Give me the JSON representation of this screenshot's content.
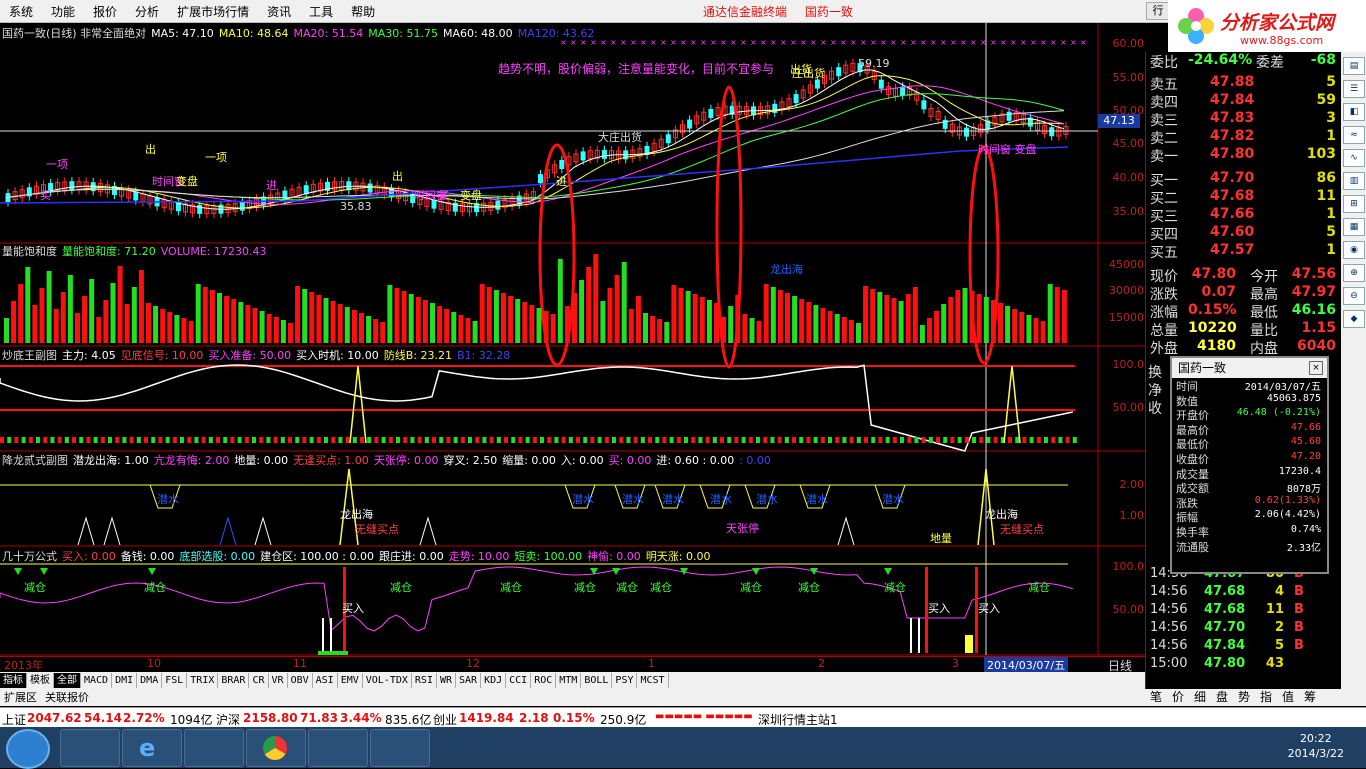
{
  "menu": [
    "系统",
    "功能",
    "报价",
    "分析",
    "扩展市场行情",
    "资讯",
    "工具",
    "帮助"
  ],
  "app_title": [
    "通达信金融终端",
    "国药一致"
  ],
  "logo": {
    "text": "分析家公式网",
    "url": "www.88gs.com"
  },
  "main_legend": {
    "prefix": "国药一致(日线) 非常全面绝对",
    "ma": [
      {
        "label": "MA5: 47.10",
        "color": "#ffffff"
      },
      {
        "label": "MA10: 48.64",
        "color": "#ffff40"
      },
      {
        "label": "MA20: 51.54",
        "color": "#ff40ff"
      },
      {
        "label": "MA30: 51.75",
        "color": "#40ff40"
      },
      {
        "label": "MA60: 48.00",
        "color": "#ffffff"
      },
      {
        "label": "MA120: 43.62",
        "color": "#4040ff"
      }
    ]
  },
  "main_axis": [
    "60.00",
    "55.00",
    "50.00",
    "45.00",
    "40.00",
    "35.00"
  ],
  "current_price_tag": "47.13",
  "annotation_top": "趋势不明，股价偏弱，注意量能变化，目前不宜参与",
  "chart_texts": {
    "low_price": "35.83",
    "high_price": "59.19",
    "vol_label": "龙出海",
    "top1": "大庄出货",
    "top2": "庄出货",
    "labels": [
      "一项",
      "出",
      "买",
      "一项",
      "进",
      "出",
      "买",
      "进",
      "时间窗",
      "变盘",
      "时间窗",
      "变盘",
      "时间窗 变盘",
      "出货"
    ]
  },
  "vol_legend": {
    "name": "量能饱和度",
    "items": [
      {
        "label": "量能饱和度: 71.20",
        "color": "#40ff40"
      },
      {
        "label": "VOLUME: 17230.43",
        "color": "#ff40ff"
      }
    ]
  },
  "vol_axis": [
    "45000",
    "30000",
    "15000"
  ],
  "ind1_legend": {
    "name": "炒底王副图",
    "items": [
      {
        "label": "主力: 4.05",
        "color": "#ffffff"
      },
      {
        "label": "见底信号: 10.00",
        "color": "#ff4040"
      },
      {
        "label": "买入准备: 50.00",
        "color": "#ff40ff"
      },
      {
        "label": "买入时机: 10.00",
        "color": "#ffffff"
      },
      {
        "label": "防线B: 23.21",
        "color": "#ffff40"
      },
      {
        "label": "B1: 32.28",
        "color": "#4040ff"
      }
    ]
  },
  "ind1_axis": [
    "100.0",
    "50.00"
  ],
  "ind2_legend": {
    "name": "降龙贰式副图",
    "items": [
      {
        "label": "潜龙出海: 1.00",
        "color": "#ffffff"
      },
      {
        "label": "亢龙有悔: 2.00",
        "color": "#ff40ff"
      },
      {
        "label": "地量: 0.00",
        "color": "#ffffff"
      },
      {
        "label": "无逢买点: 1.00",
        "color": "#ff4040"
      },
      {
        "label": "天张停: 0.00",
        "color": "#ff40ff"
      },
      {
        "label": "穿叉: 2.50",
        "color": "#ffffff"
      },
      {
        "label": "缩量: 0.00",
        "color": "#ffffff"
      },
      {
        "label": "入: 0.00",
        "color": "#ffffff"
      },
      {
        "label": "买: 0.00",
        "color": "#ff40ff"
      },
      {
        "label": "进: 0.60 : 0.00",
        "color": "#ffffff"
      },
      {
        "label": ": 0.00",
        "color": "#4040ff"
      }
    ]
  },
  "ind2_axis": [
    "2.00",
    "1.00"
  ],
  "ind2_texts": {
    "water": "潜水",
    "sky": "天张停",
    "dragon": "龙出海",
    "buy": "无缝买点",
    "ground": "地量"
  },
  "ind3_legend": {
    "name": "几十万公式",
    "items": [
      {
        "label": "买入: 0.00",
        "color": "#ff4040"
      },
      {
        "label": "备钱: 0.00",
        "color": "#ffffff"
      },
      {
        "label": "底部选股: 0.00",
        "color": "#40ffff"
      },
      {
        "label": "建仓区: 100.00 : 0.00",
        "color": "#ffffff"
      },
      {
        "label": "跟庄进: 0.00",
        "color": "#ffffff"
      },
      {
        "label": "走势: 10.00",
        "color": "#ff40ff"
      },
      {
        "label": "短卖: 100.00",
        "color": "#40ff40"
      },
      {
        "label": "神偷: 0.00",
        "color": "#ff40ff"
      },
      {
        "label": "明天涨: 0.00",
        "color": "#ffff40"
      }
    ]
  },
  "ind3_axis": [
    "100.0",
    "50.00"
  ],
  "ind3_texts": {
    "reduce": "减仓",
    "buy": "买入"
  },
  "time_axis": {
    "labels": [
      "2013年",
      "10",
      "11",
      "12",
      "1",
      "2",
      "3"
    ],
    "cursor_date": "2014/03/07/五",
    "period": "日线"
  },
  "quote": {
    "weibi": {
      "label": "委比",
      "value": "-24.64%",
      "label2": "委差",
      "value2": "-68"
    },
    "sell": [
      {
        "label": "卖五",
        "price": "47.88",
        "vol": "5"
      },
      {
        "label": "卖四",
        "price": "47.84",
        "vol": "59"
      },
      {
        "label": "卖三",
        "price": "47.83",
        "vol": "3"
      },
      {
        "label": "卖二",
        "price": "47.82",
        "vol": "1"
      },
      {
        "label": "卖一",
        "price": "47.80",
        "vol": "103"
      }
    ],
    "buy": [
      {
        "label": "买一",
        "price": "47.70",
        "vol": "86"
      },
      {
        "label": "买二",
        "price": "47.68",
        "vol": "11"
      },
      {
        "label": "买三",
        "price": "47.66",
        "vol": "1"
      },
      {
        "label": "买四",
        "price": "47.60",
        "vol": "5"
      },
      {
        "label": "买五",
        "price": "47.57",
        "vol": "1"
      }
    ],
    "stats": [
      {
        "l1": "现价",
        "v1": "47.80",
        "l2": "今开",
        "v2": "47.56"
      },
      {
        "l1": "涨跌",
        "v1": "0.07",
        "l2": "最高",
        "v2": "47.97"
      },
      {
        "l1": "涨幅",
        "v1": "0.15%",
        "l2": "最低",
        "v2": "46.16"
      },
      {
        "l1": "总量",
        "v1": "10220",
        "l2": "量比",
        "v2": "1.15"
      },
      {
        "l1": "外盘",
        "v1": "4180",
        "l2": "内盘",
        "v2": "6040"
      }
    ],
    "partial": [
      "换",
      "净",
      "收"
    ],
    "ticks": [
      {
        "t": "14:56",
        "p": "47.67",
        "v": "80",
        "d": "B"
      },
      {
        "t": "14:56",
        "p": "47.68",
        "v": "4",
        "d": "B"
      },
      {
        "t": "14:56",
        "p": "47.68",
        "v": "11",
        "d": "B"
      },
      {
        "t": "14:56",
        "p": "47.70",
        "v": "2",
        "d": "B"
      },
      {
        "t": "14:56",
        "p": "47.84",
        "v": "5",
        "d": "B"
      },
      {
        "t": "15:00",
        "p": "47.80",
        "v": "43",
        "d": ""
      }
    ]
  },
  "popup": {
    "title": "国药一致",
    "rows": [
      {
        "k": "时间",
        "v": "2014/03/07/五",
        "c": "#ffffff"
      },
      {
        "k": "数值",
        "v": "45063.875",
        "c": "#ffffff"
      },
      {
        "k": "开盘价",
        "v": "46.48 (-0.21%)",
        "c": "#40ff40"
      },
      {
        "k": "最高价",
        "v": "47.66",
        "c": "#ff4040"
      },
      {
        "k": "最低价",
        "v": "45.60",
        "c": "#ff4040"
      },
      {
        "k": "收盘价",
        "v": "47.20",
        "c": "#ff4040"
      },
      {
        "k": "成交量",
        "v": "17230.4",
        "c": "#ffffff"
      },
      {
        "k": "成交额",
        "v": "8078万",
        "c": "#ffffff"
      },
      {
        "k": "涨跌",
        "v": "0.62(1.33%)",
        "c": "#ff4040"
      },
      {
        "k": "振幅",
        "v": "2.06(4.42%)",
        "c": "#ffffff"
      },
      {
        "k": "换手率",
        "v": "0.74%",
        "c": "#ffffff"
      },
      {
        "k": "流通股",
        "v": "2.33亿",
        "c": "#ffffff"
      }
    ]
  },
  "bottom_tabs": [
    "指标",
    "模板",
    "全部",
    "MACD",
    "DMI",
    "DMA",
    "FSL",
    "TRIX",
    "BRAR",
    "CR",
    "VR",
    "OBV",
    "ASI",
    "EMV",
    "VOL-TDX",
    "RSI",
    "WR",
    "SAR",
    "KDJ",
    "CCI",
    "ROC",
    "MTM",
    "BOLL",
    "PSY",
    "MCST"
  ],
  "bottom_tabs2": [
    "扩展区",
    "关联报价"
  ],
  "right_tabs": [
    "笔",
    "价",
    "细",
    "盘",
    "势",
    "指",
    "值",
    "筹"
  ],
  "status": {
    "sh": {
      "label": "上证",
      "v": "2047.62",
      "chg": "54.14",
      "pct": "2.72%",
      "amt": "1094亿"
    },
    "sz": {
      "label": "沪深",
      "v": "2158.80",
      "chg": "71.83",
      "pct": "3.44%",
      "amt": "835.6亿"
    },
    "cy": {
      "label": "创业",
      "v": "1419.84",
      "chg": "2.18",
      "pct": "0.15%",
      "amt": "250.9亿"
    },
    "server": "深圳行情主站1"
  },
  "clock": {
    "time": "20:22",
    "date": "2014/3/22"
  },
  "colors": {
    "up": "#ff3030",
    "down": "#30ff30",
    "accent": "#e01010"
  }
}
